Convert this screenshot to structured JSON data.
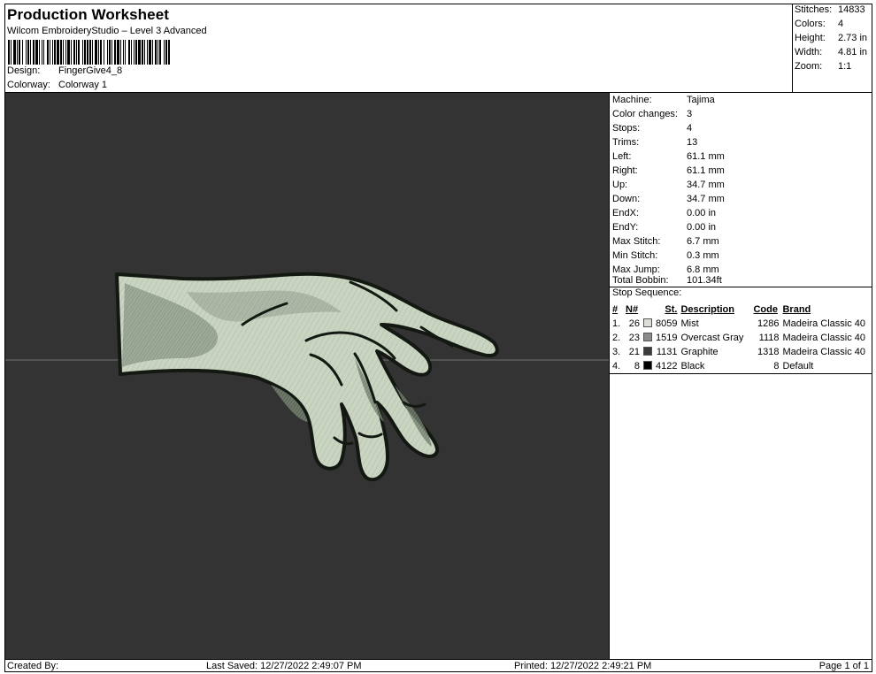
{
  "header": {
    "title": "Production Worksheet",
    "software": "Wilcom EmbroideryStudio – Level 3 Advanced",
    "design_label": "Design:",
    "design_value": "FingerGive4_8",
    "colorway_label": "Colorway:",
    "colorway_value": "Colorway 1"
  },
  "summary": [
    {
      "label": "Stitches:",
      "value": "14833"
    },
    {
      "label": "Colors:",
      "value": "4"
    },
    {
      "label": "Height:",
      "value": "2.73 in"
    },
    {
      "label": "Width:",
      "value": "4.81 in"
    },
    {
      "label": "Zoom:",
      "value": "1:1"
    }
  ],
  "details": [
    {
      "label": "Machine:",
      "value": "Tajima"
    },
    {
      "label": "Color changes:",
      "value": "3"
    },
    {
      "label": "Stops:",
      "value": "4"
    },
    {
      "label": "Trims:",
      "value": "13"
    },
    {
      "label": "Left:",
      "value": "61.1 mm"
    },
    {
      "label": "Right:",
      "value": "61.1 mm"
    },
    {
      "label": "Up:",
      "value": "34.7 mm"
    },
    {
      "label": "Down:",
      "value": "34.7 mm"
    },
    {
      "label": "EndX:",
      "value": "0.00 in"
    },
    {
      "label": "EndY:",
      "value": "0.00 in"
    },
    {
      "label": "Max Stitch:",
      "value": "6.7 mm"
    },
    {
      "label": "Min Stitch:",
      "value": "0.3 mm"
    },
    {
      "label": "Max Jump:",
      "value": "6.8 mm"
    },
    {
      "label": "Total Bobbin:",
      "value": "101.34ft"
    }
  ],
  "stop_sequence": {
    "title": "Stop Sequence:",
    "headers": {
      "idx": "#",
      "num": "N#",
      "st": "St.",
      "desc": "Description",
      "code": "Code",
      "brand": "Brand"
    },
    "rows": [
      {
        "idx": "1.",
        "num": "26",
        "color": "#dcdcd8",
        "st": "8059",
        "desc": "Mist",
        "code": "1286",
        "brand": "Madeira Classic 40"
      },
      {
        "idx": "2.",
        "num": "23",
        "color": "#8a8a88",
        "st": "1519",
        "desc": "Overcast Gray",
        "code": "1118",
        "brand": "Madeira Classic 40"
      },
      {
        "idx": "3.",
        "num": "21",
        "color": "#3c3c3c",
        "st": "1131",
        "desc": "Graphite",
        "code": "1318",
        "brand": "Madeira Classic 40"
      },
      {
        "idx": "4.",
        "num": "8",
        "color": "#000000",
        "st": "4122",
        "desc": "Black",
        "code": "8",
        "brand": "Default"
      }
    ]
  },
  "footer": {
    "created_by": "Created By:",
    "last_saved": "Last Saved: 12/27/2022 2:49:07 PM",
    "printed": "Printed: 12/27/2022 2:49:21 PM",
    "page": "Page 1 of 1"
  },
  "colors": {
    "preview_bg": "#333333",
    "thread_light": "#c8d3bf",
    "thread_outline": "#1a1f17"
  }
}
